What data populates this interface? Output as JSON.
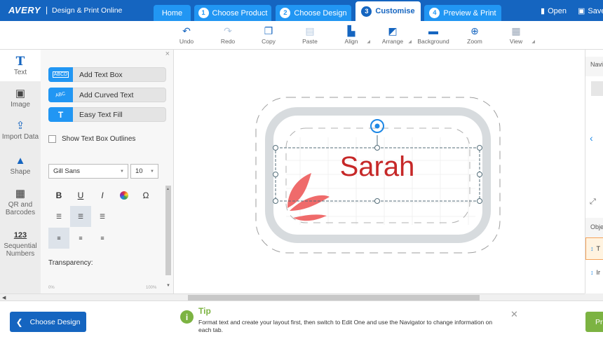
{
  "header": {
    "brand": "AVERY",
    "separator": "|",
    "subtitle": "Design & Print Online",
    "tabs": [
      {
        "num": "",
        "label": "Home"
      },
      {
        "num": "1",
        "label": "Choose Product"
      },
      {
        "num": "2",
        "label": "Choose Design"
      },
      {
        "num": "3",
        "label": "Customise"
      },
      {
        "num": "4",
        "label": "Preview & Print"
      }
    ],
    "open_label": "Open",
    "save_label": "Save"
  },
  "toolbar": {
    "items": [
      {
        "label": "Undo",
        "icon": "undo-icon",
        "glyph": "↶"
      },
      {
        "label": "Redo",
        "icon": "redo-icon",
        "glyph": "↷"
      },
      {
        "label": "Copy",
        "icon": "copy-icon",
        "glyph": "❐"
      },
      {
        "label": "Paste",
        "icon": "paste-icon",
        "glyph": "📋"
      },
      {
        "label": "Align",
        "icon": "align-icon",
        "glyph": "⊫"
      },
      {
        "label": "Arrange",
        "icon": "arrange-icon",
        "glyph": "◫"
      },
      {
        "label": "Background",
        "icon": "background-icon",
        "glyph": "▭"
      },
      {
        "label": "Zoom",
        "icon": "zoom-icon",
        "glyph": "⊕"
      },
      {
        "label": "View",
        "icon": "grid-icon",
        "glyph": "#"
      }
    ]
  },
  "sidebar": {
    "items": [
      {
        "label": "Text",
        "icon": "text-icon",
        "glyph": "T"
      },
      {
        "label": "Image",
        "icon": "image-icon",
        "glyph": "🖼"
      },
      {
        "label": "Import Data",
        "icon": "import-data-icon",
        "glyph": "⇪"
      },
      {
        "label": "Shape",
        "icon": "shape-icon",
        "glyph": "▲"
      },
      {
        "label": "QR and Barcodes",
        "icon": "qr-code-icon",
        "glyph": "▦"
      },
      {
        "label": "123",
        "label2": "Sequential Numbers",
        "icon": "sequential-numbers-icon"
      }
    ]
  },
  "text_panel": {
    "close": "×",
    "add_text_box": "Add Text Box",
    "add_text_box_icon": "ABCD",
    "add_curved_text": "Add Curved Text",
    "add_curved_text_icon": "ABC",
    "easy_text_fill": "Easy Text Fill",
    "easy_text_fill_icon": "T",
    "show_outlines": "Show Text Box Outlines",
    "font_family": "Gill Sans",
    "font_size": "10",
    "bold": "B",
    "underline": "U",
    "italic": "I",
    "special_char": "Ω",
    "transparency_label": "Transparency:",
    "transparency_min": "0%",
    "transparency_max": "100%"
  },
  "canvas": {
    "label_text": "Sarah",
    "label_color": "#c62828",
    "leaf_color": "#ef6b6b"
  },
  "right_panel": {
    "navigator_label": "Navi",
    "objects_label": "Obje",
    "object_1": "T",
    "object_2": "Ir"
  },
  "bottom": {
    "back_label": "Choose Design",
    "tip_title": "Tip",
    "tip_text": "Format text and create your layout first, then switch to Edit One and use the Navigator to change information on each tab.",
    "next_label": "Pr"
  },
  "colors": {
    "brand_blue": "#1565c0",
    "tab_blue": "#2196f3",
    "green": "#7cb342"
  }
}
